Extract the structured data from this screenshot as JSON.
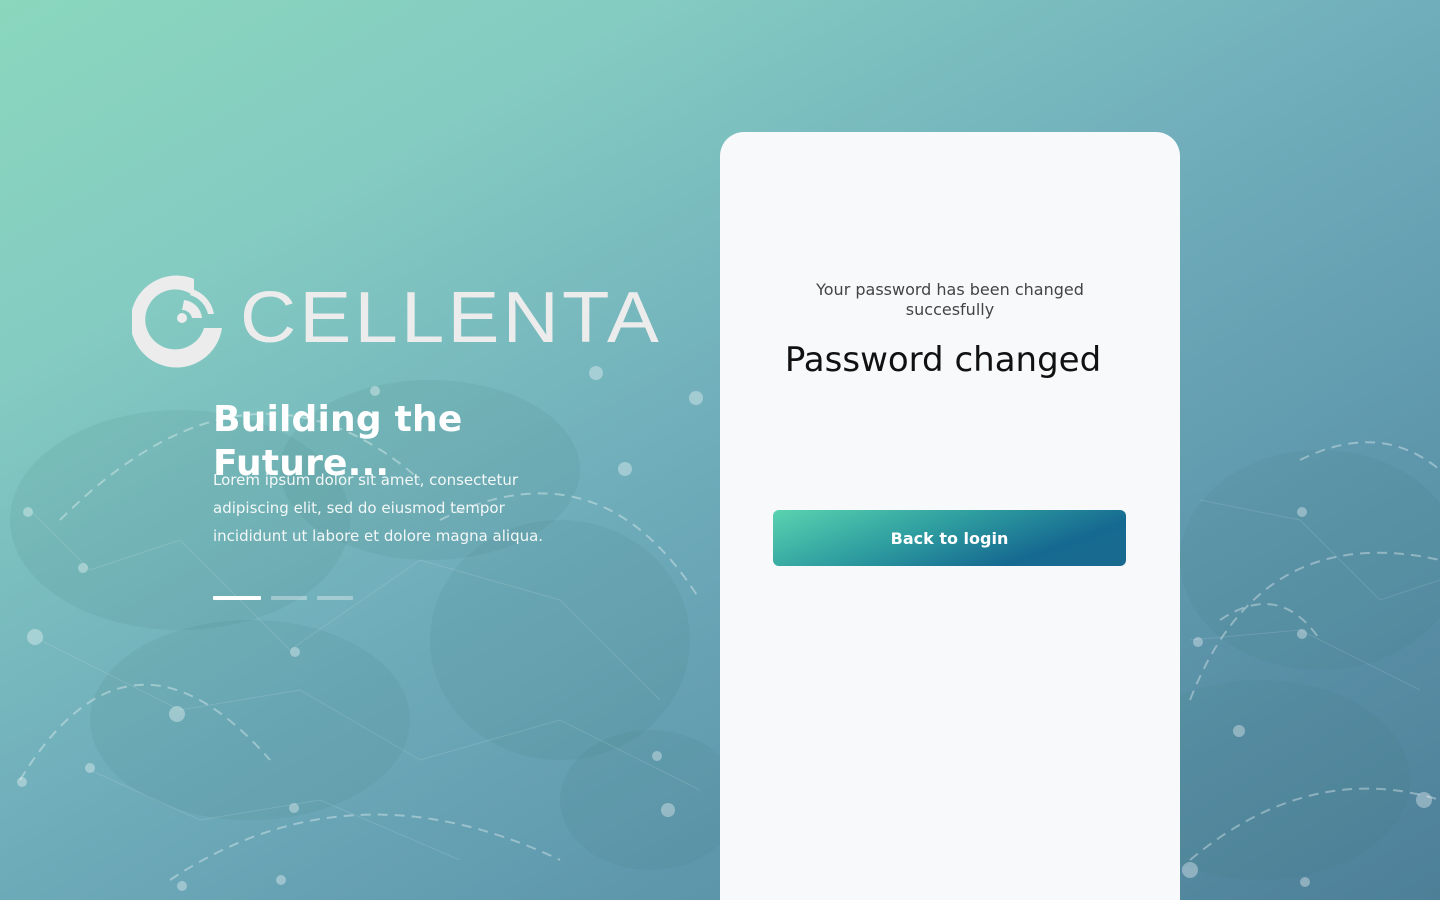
{
  "brand": {
    "logo_icon": "signal-ring-icon",
    "name": "CELLENTA",
    "color": "#ececec"
  },
  "hero": {
    "headline": "Building the Future...",
    "description": "Lorem ipsum dolor sit amet, consectetur adipiscing elit, sed do eiusmod tempor incididunt ut labore et dolore magna aliqua.",
    "carousel": {
      "count": 3,
      "active_index": 0
    }
  },
  "card": {
    "title": "Password changed",
    "message": "Your password has been changed succesfully",
    "button_label": "Back to login"
  },
  "colors": {
    "background_start": "#8ad7bd",
    "background_end": "#4d7f98",
    "card": "#f8f9fa",
    "button_start": "#5ad3b0",
    "button_end": "#166a91"
  }
}
